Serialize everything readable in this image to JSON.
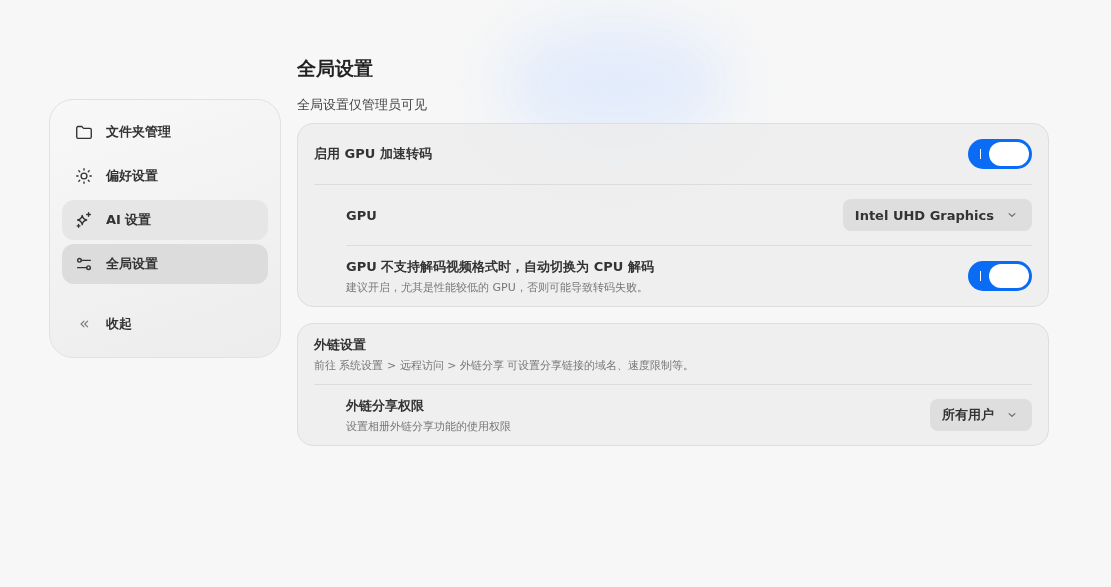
{
  "sidebar": {
    "items": [
      {
        "kind": "folder",
        "label": "文件夹管理",
        "selected": false,
        "hovered": false
      },
      {
        "kind": "sun",
        "label": "偏好设置",
        "selected": false,
        "hovered": false
      },
      {
        "kind": "sparkle",
        "label": "AI 设置",
        "selected": false,
        "hovered": true
      },
      {
        "kind": "sliders",
        "label": "全局设置",
        "selected": true,
        "hovered": false
      }
    ],
    "collapse": {
      "label": "收起"
    }
  },
  "page": {
    "title": "全局设置",
    "subtitle": "全局设置仅管理员可见"
  },
  "sections": [
    {
      "header": {
        "kind": "toggle",
        "label": "启用 GPU 加速转码",
        "on": true
      },
      "rows": [
        {
          "kind": "select",
          "label": "GPU",
          "value": "Intel UHD Graphics"
        },
        {
          "kind": "toggle",
          "label": "GPU 不支持解码视频格式时，自动切换为 CPU 解码",
          "description": "建议开启，尤其是性能较低的 GPU，否则可能导致转码失败。",
          "on": true
        }
      ]
    },
    {
      "header": {
        "kind": "info",
        "label": "外链设置",
        "description": "前往 系统设置 > 远程访问 > 外链分享 可设置分享链接的域名、速度限制等。"
      },
      "rows": [
        {
          "kind": "select",
          "label": "外链分享权限",
          "description": "设置相册外链分享功能的使用权限",
          "value": "所有用户"
        }
      ]
    }
  ]
}
